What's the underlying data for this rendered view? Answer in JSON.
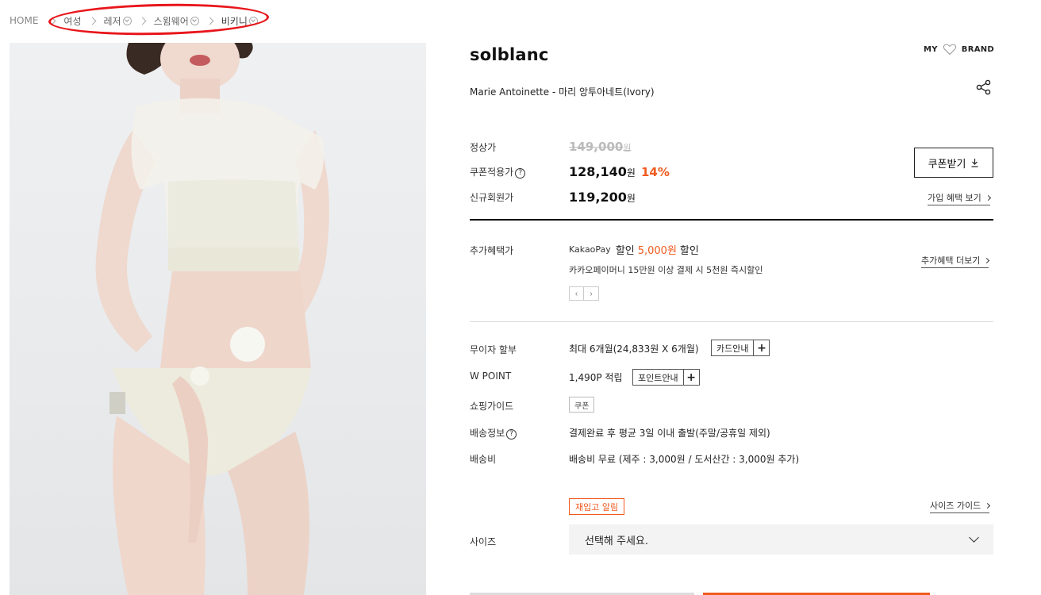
{
  "breadcrumb": {
    "home": "HOME",
    "items": [
      "여성",
      "레저",
      "스윔웨어",
      "비키니"
    ]
  },
  "product": {
    "brand": "solblanc",
    "name": "Marie Antoinette - 마리 앙투아네트(Ivory)",
    "my_label": "MY",
    "brand_label": "BRAND"
  },
  "pricing": {
    "regular_label": "정상가",
    "regular_price": "149,000",
    "coupon_label": "쿠폰적용가",
    "coupon_price": "128,140",
    "discount": "14%",
    "member_label": "신규회원가",
    "member_price": "119,200",
    "won": "원",
    "coupon_button": "쿠폰받기",
    "join_benefit_link": "가입 혜택 보기"
  },
  "benefits": {
    "label": "추가혜택가",
    "pay_name": "KakaoPay",
    "discount_word": "할인",
    "amount": "5,000원",
    "description": "카카오페이머니 15만원 이상 결제 시 5천원 즉시할인",
    "more_link": "추가혜택 더보기"
  },
  "info": {
    "installment_label": "무이자 할부",
    "installment_value": "최대 6개월(24,833원 X 6개월)",
    "card_button": "카드안내",
    "point_label": "W POINT",
    "point_value": "1,490P 적립",
    "point_button": "포인트안내",
    "guide_label": "쇼핑가이드",
    "guide_tag": "쿠폰",
    "shipping_label": "배송정보",
    "shipping_value": "결제완료 후 평균 3일 이내 출발(주말/공휴일 제외)",
    "fee_label": "배송비",
    "fee_value": "배송비 무료 (제주 : 3,000원 / 도서산간 : 3,000원 추가)"
  },
  "size": {
    "restock_button": "재입고 알림",
    "guide_link": "사이즈 가이드",
    "label": "사이즈",
    "placeholder": "선택해 주세요."
  },
  "colors": {
    "accent": "#f05a1e",
    "highlight": "#e8161b"
  }
}
